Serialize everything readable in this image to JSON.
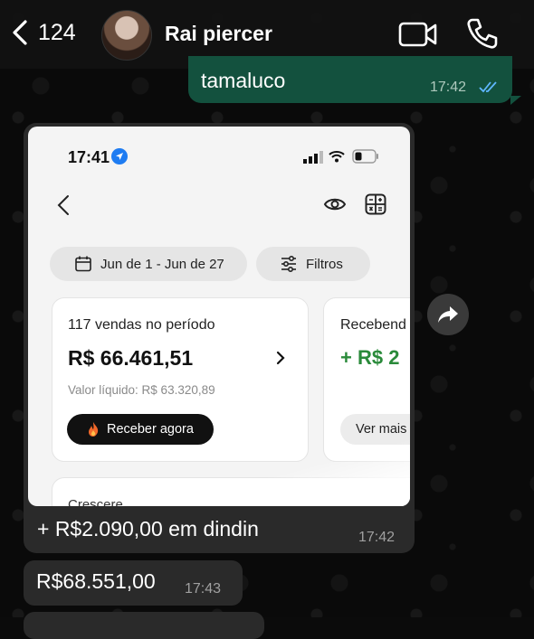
{
  "header": {
    "back_count": "124",
    "contact_name": "Rai piercer"
  },
  "messages": {
    "outgoing_1": {
      "text": "tamaluco",
      "time": "17:42",
      "status": "read"
    },
    "incoming_image": {
      "caption": "+ R$2.090,00 em dindin",
      "time": "17:42",
      "screenshot": {
        "status_time": "17:41",
        "date_chip": "Jun de 1 - Jun de 27",
        "filter_chip": "Filtros",
        "card_main": {
          "label": "117 vendas no período",
          "amount": "R$ 66.461,51",
          "net_value": "Valor líquido: R$ 63.320,89",
          "button": "Receber agora"
        },
        "card_second": {
          "label": "Recebend",
          "amount": "+ R$ 2",
          "button": "Ver mais"
        },
        "card_bottom": {
          "label": "Crescere"
        }
      }
    },
    "incoming_2": {
      "text": "R$68.551,00",
      "time": "17:43"
    }
  },
  "colors": {
    "outgoing_bubble": "#13513e",
    "incoming_bubble": "#2a2a2a",
    "read_ticks": "#5fb7ff",
    "positive_amount": "#2a8a3a"
  }
}
